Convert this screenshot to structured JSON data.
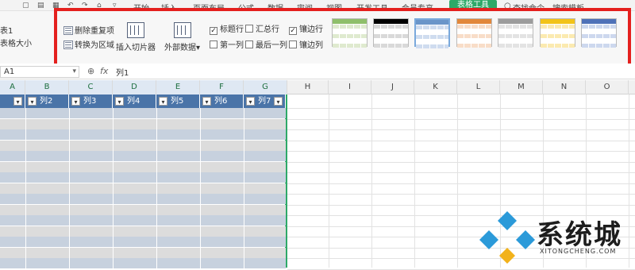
{
  "menubar": {
    "items": [
      "开始",
      "插入",
      "页面布局",
      "公式",
      "数据",
      "审阅",
      "视图",
      "开发工具",
      "会员专享"
    ],
    "active_tab": "表格工具",
    "search": "查找命令、搜索模板"
  },
  "ribbon": {
    "table_name_value": "表1",
    "resize_label": "表格大小",
    "remove_dup": "删除重复项",
    "to_range": "转换为区域",
    "slicer": "插入切片器",
    "external": "外部数据",
    "options": {
      "header_row": "标题行",
      "total_row": "汇总行",
      "banded_rows": "镶边行",
      "first_col": "第一列",
      "last_col": "最后一列",
      "banded_cols": "镶边列"
    },
    "option_states": {
      "header_row": true,
      "total_row": false,
      "banded_rows": true,
      "first_col": false,
      "last_col": false,
      "banded_cols": false
    }
  },
  "styles": [
    {
      "head": "#8fbf6b",
      "row": "#dfeacf"
    },
    {
      "head": "#000000",
      "row": "#d9d9d9"
    },
    {
      "head": "#6a95c9",
      "row": "#cfdcef"
    },
    {
      "head": "#e2873a",
      "row": "#f8ddc8"
    },
    {
      "head": "#9c9c9c",
      "row": "#e3e3e3"
    },
    {
      "head": "#f2c318",
      "row": "#fbeab0"
    },
    {
      "head": "#4e71b8",
      "row": "#cdd8ee"
    }
  ],
  "namebox": "A1",
  "formula": "列1",
  "formula_icons": {
    "zoom": "magnify-icon",
    "fx": "fx"
  },
  "columns": [
    "A",
    "B",
    "C",
    "D",
    "E",
    "F",
    "G",
    "H",
    "I",
    "J",
    "K",
    "L",
    "M",
    "N",
    "O"
  ],
  "table_headers": [
    "列2",
    "列3",
    "列4",
    "列5",
    "列6",
    "列7"
  ],
  "accent": "#2ea968",
  "watermark": {
    "title": "系统城",
    "sub": "XITONGCHENG.COM"
  }
}
